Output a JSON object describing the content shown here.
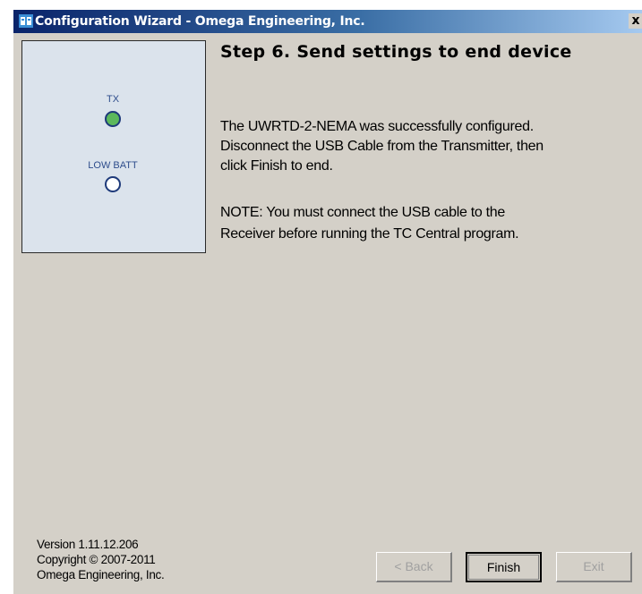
{
  "window": {
    "title": "Configuration Wizard - Omega Engineering, Inc.",
    "close_glyph": "x"
  },
  "led_panel": {
    "tx_label": "TX",
    "tx_color": "#5cb85c",
    "low_batt_label": "LOW BATT",
    "low_batt_color": "#ffffff"
  },
  "step": {
    "title": "Step 6.  Send settings to end device"
  },
  "message": {
    "line1": "The UWRTD-2-NEMA was successfully configured.",
    "line2": "Disconnect the USB Cable from the Transmitter, then",
    "line3": "click Finish to end.",
    "note_line1": "NOTE:  You must connect the USB cable to the",
    "note_line2": "Receiver before running the TC Central program."
  },
  "footer": {
    "version": "Version 1.11.12.206",
    "copyright": "Copyright © 2007-2011",
    "company": "Omega Engineering, Inc."
  },
  "buttons": {
    "back": "< Back",
    "finish": "Finish",
    "exit": "Exit"
  }
}
